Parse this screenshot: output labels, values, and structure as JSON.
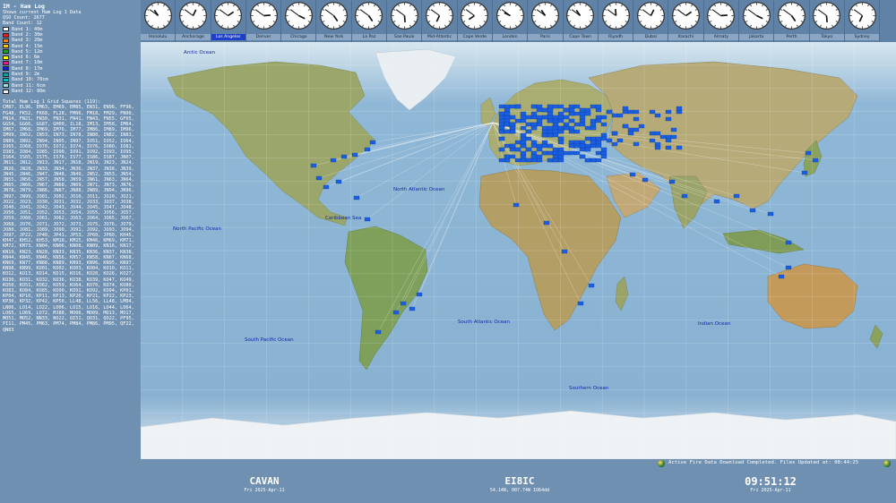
{
  "app": {
    "title": "IM - Ham Log",
    "subtitle": "Shows current Ham Log 1 Data",
    "qso_count": "QSO Count: 2677",
    "band_count": "Band Count: 12"
  },
  "bands": [
    {
      "label": "Band 1: 40m",
      "color": "#ffffff"
    },
    {
      "label": "Band 2: 30m",
      "color": "#e02020"
    },
    {
      "label": "Band 3: 20m",
      "color": "#f08020"
    },
    {
      "label": "Band 4: 15m",
      "color": "#f0c020"
    },
    {
      "label": "Band 5: 12m",
      "color": "#20a020"
    },
    {
      "label": "Band 6: 6m",
      "color": "#ffff00"
    },
    {
      "label": "Band 7: 10m",
      "color": "#e02080"
    },
    {
      "label": "Band 8: 17m",
      "color": "#1020c0"
    },
    {
      "label": "Band 9: 2m",
      "color": "#10a0a0"
    },
    {
      "label": "Band 10: 70cm",
      "color": "#00c0c0"
    },
    {
      "label": "Band 11: 6cm",
      "color": "#a0e0e0"
    },
    {
      "label": "Band 12: 80m",
      "color": "#f0f0f0"
    }
  ],
  "grid_list": {
    "header": "Total Ham Log 1 Grid Squares (119):",
    "text": "CM87, EL96, EM63, EM69, EM85, EN31, EN96, FF96, FG48, FK52, FK68, FL28, FM06, FM18, FM29, FN00, FN14, FN21, FN30, FN31, FN41, FN43, FN55, GF05, GG54, GG66, GG87, GH00, IL18, IM13, IM58, IM64, IM67, IM68, IM69, IM76, IM77, IM86, IM89, IM96, IM99, IN52, IN53, IN73, IN78, IN80, IN82, IN83, IN89, IN92, IN94, IN95, IN97, IO51, IO52, IO64, IO65, IO68, IO70, IO72, IO74, IO76, IO80, IO81, IO83, IO84, IO85, IO90, IO91, IO92, IO93, IO95, IS64, IS65, IS75, IS76, IS77, IS86, IS87, JN07, JN11, JN12, JN13, JN17, JN18, JN19, JN23, JN24, JN26, JN28, JN33, JN34, JN36, JN37, JN38, JN39, JN45, JN46, JN47, JN48, JN49, JN52, JN53, JN54, JN55, JN56, JN57, JN58, JN59, JN61, JN63, JN64, JN65, JN66, JN67, JN68, JN69, JN71, JN73, JN76, JN78, JN79, JN86, JN87, JN88, JN89, JN94, JN96, JN97, JN99, JO01, JO02, JO10, JO11, JO20, JO21, JO22, JO23, JO30, JO31, JO32, JO33, JO37, JO38, JO40, JO41, JO42, JO43, JO44, JO45, JO47, JO48, JO50, JO51, JO52, JO53, JO54, JO55, JO56, JO57, JO59, JO60, JO61, JO62, JO63, JO64, JO65, JO67, JO68, JO70, JO71, JO72, JO73, JO75, JO76, JO79, JO80, JO81, JO89, JO90, JO91, JO92, JO93, JO94, JO97, JP22, JP40, JP41, JP53, JP60, JP80, KH45, KH47, KH52, KH53, KM18, KM25, KM46, KM69, KM71, KM72, KM73, KN04, KN06, KN08, KN09, KN16, KN17, KN19, KN23, KN28, KN33, KN35, KN36, KN37, KN38, KN44, KN45, KN46, KN56, KN57, KN58, KN67, KN68, KN69, KN77, KN88, KN89, KN93, KN96, KN95, KN97, KN98, KN99, KO01, KO02, KO03, KO04, KO10, KO11, KO12, KO13, KO14, KO15, KO16, KO20, KO26, KO27, KO30, KO31, KO32, KO36, KO38, KO39, KO47, KO49, KO50, KO51, KO62, KO59, KO64, KO70, KO74, KO80, KO83, KO84, KO85, KO90, KO91, KO92, KO94, KP01, KP04, KP10, KP11, KP13, KP20, KP21, KP22, KP23, KP30, KP32, KP42, KP50, LL48, LL56, LL48, LM04, LN06, LO14, LO22, LO06, LO15, LO16, LO44, LO64, LO65, LO69, LO72, MJ88, MO06, MO09, MO13, MO17, MO51, MO52, NN33, NO22, QI51, QO31, QO22, PF95, PI11, PM45, PM63, PM74, PM84, PM86, PM95, QF22, QN03"
  },
  "clocks": [
    {
      "city": "Honolulu",
      "hour": 10,
      "minute": 51,
      "selected": false
    },
    {
      "city": "Anchorage",
      "hour": 12,
      "minute": 51,
      "selected": false
    },
    {
      "city": "Los Angeles",
      "hour": 1,
      "minute": 51,
      "selected": true
    },
    {
      "city": "Denver",
      "hour": 2,
      "minute": 51,
      "selected": false
    },
    {
      "city": "Chicago",
      "hour": 3,
      "minute": 51,
      "selected": false
    },
    {
      "city": "New York",
      "hour": 4,
      "minute": 51,
      "selected": false
    },
    {
      "city": "La Paz",
      "hour": 4,
      "minute": 51,
      "selected": false
    },
    {
      "city": "Sao Paulo",
      "hour": 5,
      "minute": 51,
      "selected": false
    },
    {
      "city": "Mid-Atlantic",
      "hour": 6,
      "minute": 51,
      "selected": false
    },
    {
      "city": "Cape Verde",
      "hour": 7,
      "minute": 51,
      "selected": false
    },
    {
      "city": "London",
      "hour": 9,
      "minute": 51,
      "selected": false
    },
    {
      "city": "Paris",
      "hour": 10,
      "minute": 51,
      "selected": false
    },
    {
      "city": "Cape Town",
      "hour": 10,
      "minute": 51,
      "selected": false
    },
    {
      "city": "Riyadh",
      "hour": 11,
      "minute": 51,
      "selected": false
    },
    {
      "city": "Dubai",
      "hour": 12,
      "minute": 51,
      "selected": false
    },
    {
      "city": "Karachi",
      "hour": 1,
      "minute": 51,
      "selected": false
    },
    {
      "city": "Almaty",
      "hour": 2,
      "minute": 51,
      "selected": false
    },
    {
      "city": "Jakarta",
      "hour": 3,
      "minute": 51,
      "selected": false
    },
    {
      "city": "Perth",
      "hour": 4,
      "minute": 51,
      "selected": false
    },
    {
      "city": "Tokyo",
      "hour": 5,
      "minute": 51,
      "selected": false
    },
    {
      "city": "Sydney",
      "hour": 6,
      "minute": 51,
      "selected": false
    }
  ],
  "oceans": {
    "arctic": "Arctic Ocean",
    "north_pacific": "North Pacific Ocean",
    "north_atlantic": "North Atlantic Ocean",
    "caribbean": "Caribbean Sea",
    "south_pacific": "South Pacific Ocean",
    "south_atlantic": "South Atlantic Ocean",
    "indian": "Indian Ocean",
    "southern": "Southern Ocean"
  },
  "bottom": {
    "left_name": "CAVAN",
    "left_date": "Fri 2025-Apr-11",
    "center_call": "EI8IC",
    "center_info": "54.14N, 007.74W  IO64dd",
    "right_time": "09:51:12",
    "right_date": "Fri 2025-Apr-11"
  },
  "status": {
    "text": "Active Fire Data Download Completed. Files Updated at: 08:44:25"
  },
  "colors": {
    "ocean": "#8fb7d6",
    "land": "#9aa66a",
    "grid_square": "#1a5fe0",
    "panel": "#6f90b0"
  }
}
